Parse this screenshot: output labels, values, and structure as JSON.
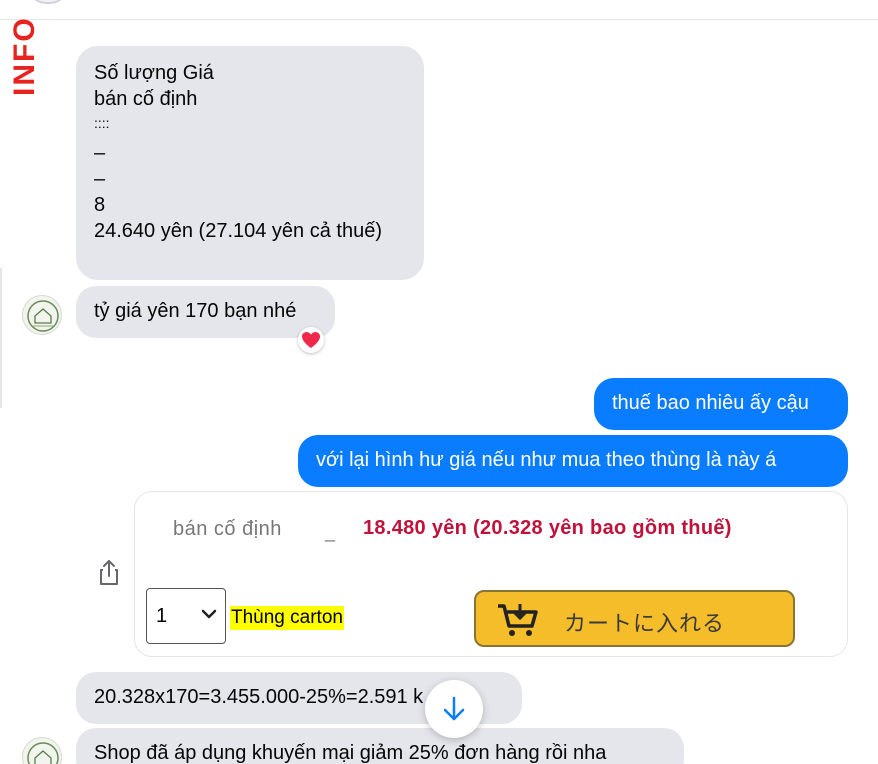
{
  "sidebar_logo_text": "INFO",
  "messages": {
    "m1_lines": [
      "Số lượng Giá",
      "bán cố định",
      "::::",
      "–",
      "–",
      "8",
      "24.640 yên (27.104 yên cả thuế)"
    ],
    "m2": "tỷ giá yên 170 bạn nhé",
    "m3": "thuế bao nhiêu ấy cậu",
    "m4": "với lại hình hư giá nếu như mua theo thùng là này á",
    "m5": "20.328x170=3.455.000-25%=2.591 k ạ",
    "m6": "Shop đã áp dụng khuyến mại giảm 25% đơn hàng rồi nha"
  },
  "image": {
    "price_label": "bán cố định",
    "price_dash": "_",
    "price_value": "18.480 yên (20.328 yên bao gồm thuế)",
    "qty_value": "1",
    "carton_label": "Thùng carton",
    "cart_button_label": "カートに入れる"
  },
  "reaction": "heart",
  "colors": {
    "outgoing_bubble": "#0a7cff",
    "incoming_bubble": "#e4e6eb",
    "price_red": "#c0123a",
    "cart_button": "#f6bd2a",
    "logo_red": "#e52420"
  },
  "icons": [
    "share-icon",
    "heart-reaction-icon",
    "arrow-down-icon",
    "cart-icon",
    "chevron-down-icon"
  ]
}
